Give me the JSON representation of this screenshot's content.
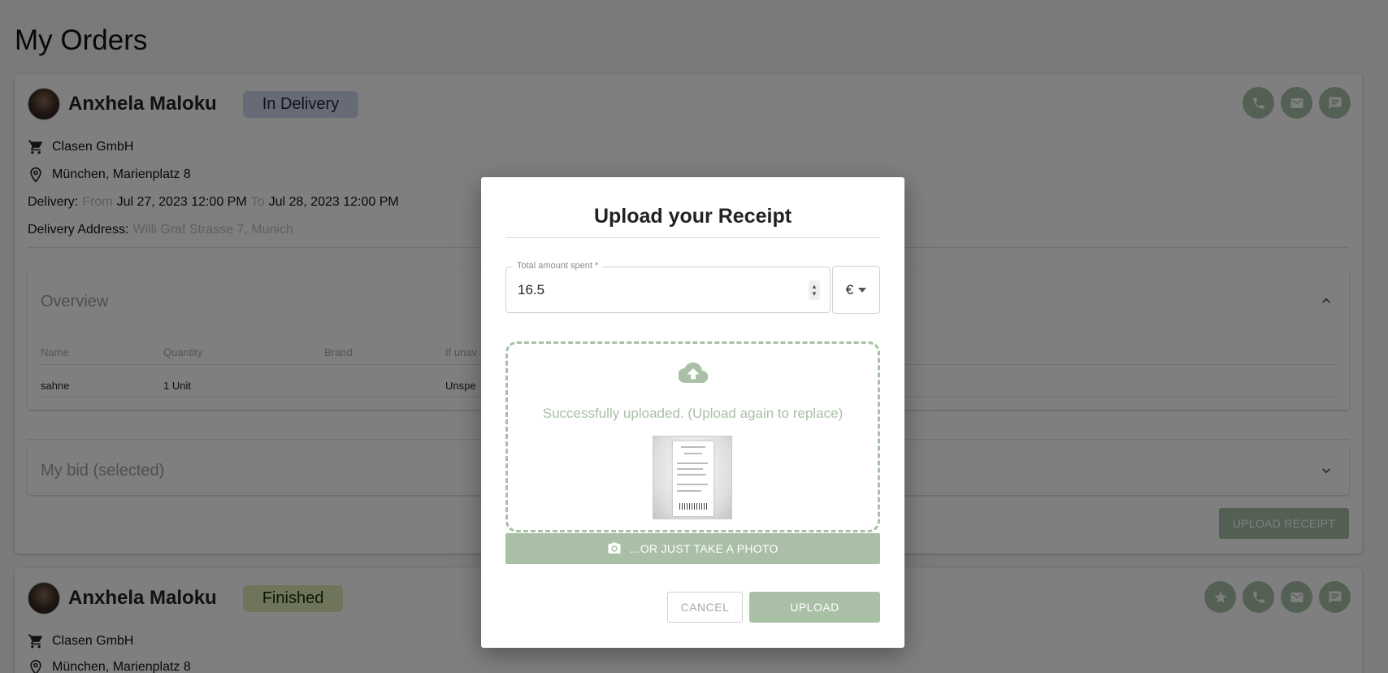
{
  "page": {
    "title": "My Orders"
  },
  "orders": [
    {
      "buyer_name": "Anxhela Maloku",
      "status": "In Delivery",
      "store": "Clasen GmbH",
      "location": "München, Marienplatz 8",
      "delivery_label": "Delivery:",
      "from_label": "From",
      "from_value": "Jul 27, 2023 12:00 PM",
      "to_label": "To",
      "to_value": "Jul 28, 2023 12:00 PM",
      "address_label": "Delivery Address:",
      "address_value": "Willi Graf Strasse 7, Munich",
      "overview": {
        "title": "Overview",
        "columns": [
          "Name",
          "Quantity",
          "Brand",
          "If unav"
        ],
        "rows": [
          [
            "sahne",
            "1 Unit",
            "",
            "Unspe"
          ]
        ]
      },
      "bid_title": "My bid (selected)",
      "upload_receipt_label": "UPLOAD RECEIPT"
    },
    {
      "buyer_name": "Anxhela Maloku",
      "status": "Finished",
      "store": "Clasen GmbH",
      "location": "München, Marienplatz 8"
    }
  ],
  "modal": {
    "title": "Upload your Receipt",
    "amount_label": "Total amount spent *",
    "amount_value": "16.5",
    "currency": "€",
    "drop_text": "Successfully uploaded. (Upload again to replace)",
    "photo_button": "...OR JUST TAKE A PHOTO",
    "cancel_button": "CANCEL",
    "upload_button": "UPLOAD"
  },
  "colors": {
    "accent": "#a9c0a6",
    "badge_delivery": "#cfd6ee",
    "badge_finished": "#dfebb4",
    "overlay": "rgba(0,0,0,0.5)"
  },
  "icons": [
    "phone-icon",
    "mail-icon",
    "chat-icon",
    "star-icon",
    "cart-icon",
    "location-pin-icon",
    "chevron-up-icon",
    "chevron-down-icon",
    "cloud-upload-icon",
    "camera-icon",
    "caret-down-icon"
  ]
}
